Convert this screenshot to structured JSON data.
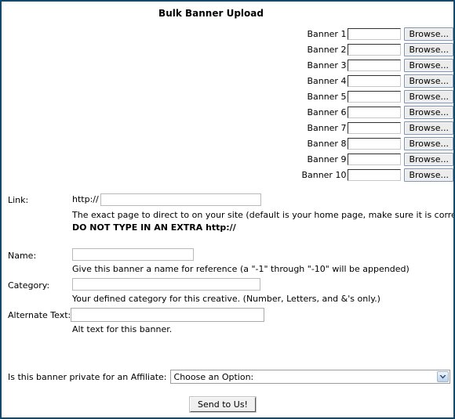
{
  "page": {
    "title": "Bulk Banner Upload",
    "accent_border_color": "#14496b",
    "background_color": "#ffffff"
  },
  "banner_uploads": {
    "browse_label": "Browse...",
    "rows": [
      {
        "label": "Banner 1",
        "value": ""
      },
      {
        "label": "Banner 2",
        "value": ""
      },
      {
        "label": "Banner 3",
        "value": ""
      },
      {
        "label": "Banner 4",
        "value": ""
      },
      {
        "label": "Banner 5",
        "value": ""
      },
      {
        "label": "Banner 6",
        "value": ""
      },
      {
        "label": "Banner 7",
        "value": ""
      },
      {
        "label": "Banner 8",
        "value": ""
      },
      {
        "label": "Banner 9",
        "value": ""
      },
      {
        "label": "Banner 10",
        "value": ""
      }
    ]
  },
  "link_section": {
    "label": "Link:",
    "prefix": "http://",
    "value": "",
    "hint": "The exact page to direct to on your site (default is your home page, make sure it is correct)",
    "warning": "DO NOT TYPE IN AN EXTRA http://"
  },
  "name_section": {
    "label": "Name:",
    "value": "",
    "hint": "Give this banner a name for reference (a \"-1\" through \"-10\" will be appended)"
  },
  "category_section": {
    "label": "Category:",
    "value": "",
    "hint": "Your defined category for this creative. (Number, Letters, and &'s only.)"
  },
  "alt_text_section": {
    "label": "Alternate Text:",
    "value": "",
    "hint": "Alt text for this banner."
  },
  "affiliate_section": {
    "label": "Is this banner private for an Affiliate:",
    "selected": "Choose an Option:"
  },
  "submit": {
    "label": "Send to Us!"
  }
}
